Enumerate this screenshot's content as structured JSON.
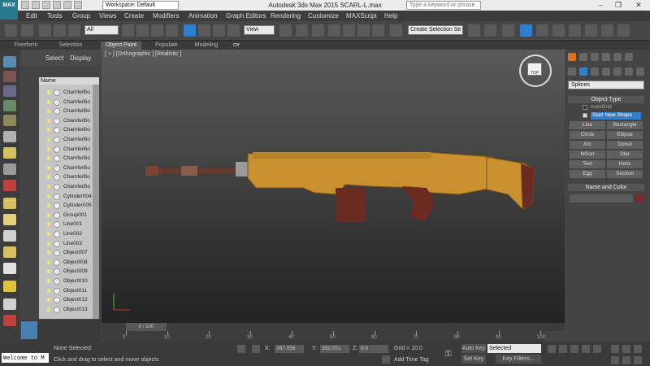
{
  "app": {
    "title": "Autodesk 3ds Max  2015    SCARL-L.max",
    "logo_text": "MAX",
    "workspace": "Workspace: Default",
    "search_placeholder": "Type a keyword or phrase"
  },
  "menu": [
    "Edit",
    "Tools",
    "Group",
    "Views",
    "Create",
    "Modifiers",
    "Animation",
    "Graph Editors",
    "Rendering",
    "Customize",
    "MAXScript",
    "Help"
  ],
  "toolbar": {
    "selection_filter": "All",
    "ref_coord": "View",
    "named_selection": "Create Selection Se"
  },
  "ribbon_tabs": [
    "Freeform",
    "Selection",
    "Object Paint",
    "Populate",
    "Modeling"
  ],
  "explorer": {
    "menus": [
      "Select",
      "Display"
    ],
    "column_header": "Name",
    "rows": [
      "ChamferBo",
      "ChamferBo",
      "ChamferBo",
      "ChamferBo",
      "ChamferBo",
      "ChamferBo",
      "ChamferBo",
      "ChamferBo",
      "ChamferBo",
      "ChamferBo",
      "ChamferBo",
      "Cylinder004",
      "Cylinder005",
      "Group001",
      "Line001",
      "Line002",
      "Line003",
      "Object007",
      "Object008",
      "Object009",
      "Object010",
      "Object011",
      "Object012",
      "Object013"
    ]
  },
  "viewport": {
    "label": "[ + ] [Orthographic ] [Realistic ]",
    "viewcube_label": "TOP"
  },
  "command_panel": {
    "category_dropdown": "Splines",
    "object_type_header": "Object Type",
    "autogrid": "AutoGrid",
    "start_new_shape": "Start New Shape",
    "shapes": [
      "Line",
      "Rectangle",
      "Circle",
      "Ellipse",
      "Arc",
      "Donut",
      "NGon",
      "Star",
      "Text",
      "Helix",
      "Egg",
      "Section"
    ],
    "name_color_header": "Name and Color"
  },
  "timeline": {
    "frame_display": "0 / 100",
    "ticks": [
      "0",
      "10",
      "20",
      "30",
      "40",
      "50",
      "60",
      "70",
      "80",
      "90",
      "100"
    ]
  },
  "status": {
    "maxscript": "Welcome to M",
    "selection": "None Selected",
    "prompt": "Click and drag to select and move objects",
    "x_label": "X:",
    "x_value": "267.056",
    "y_label": "Y:",
    "y_value": "352.551",
    "z_label": "Z:",
    "z_value": "0.0",
    "grid": "Grid = 10.0",
    "add_time_tag": "Add Time Tag",
    "auto_key": "Auto Key",
    "selected": "Selected",
    "set_key": "Set Key",
    "key_filters": "Key Filters..."
  },
  "colors": {
    "accent": "#2e7fd0",
    "rifle_body": "#c8902e",
    "rifle_grip": "#6b2a22"
  }
}
